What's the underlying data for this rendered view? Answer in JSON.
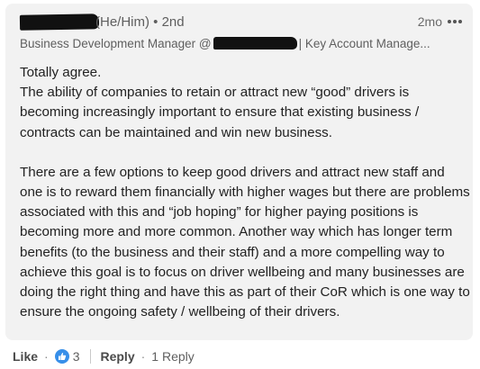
{
  "comment": {
    "author_suffix": "(He/Him) • 2nd",
    "timestamp": "2mo",
    "more_icon": "more-horizontal-icon",
    "headline_prefix": "Business Development Manager @",
    "headline_suffix": "| Key Account Manage...",
    "paragraphs": [
      "Totally agree.\nThe ability of companies to retain or attract new “good” drivers is becoming increasingly important to ensure that existing business / contracts can be maintained and win new business.",
      "There are a few options to keep good drivers and attract new staff and one is to reward them financially with higher wages but there are problems associated with this and “job hoping” for higher paying positions is becoming more and more common. Another way which has longer term benefits (to the business and their staff) and a more compelling way to achieve this goal is to focus on driver wellbeing and many businesses are doing the right thing and have this as part of their CoR which is one way to ensure the ongoing safety / wellbeing of their drivers."
    ]
  },
  "actions": {
    "like_label": "Like",
    "like_count": "3",
    "reply_label": "Reply",
    "reply_count": "1 Reply",
    "like_icon": "thumbs-up-icon",
    "like_icon_color": "#378fe9"
  }
}
